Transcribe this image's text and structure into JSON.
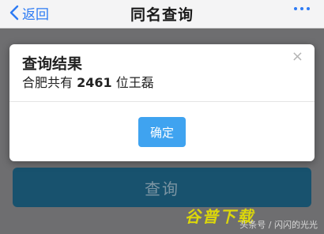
{
  "navbar": {
    "back_label": "返回",
    "title": "同名查询",
    "more_icon": "more-dots-icon",
    "accent_color": "#2d7bf4"
  },
  "page": {
    "query_button_label": "查询"
  },
  "dialog": {
    "title": "查询结果",
    "body_prefix": "合肥共有",
    "count": "2461",
    "body_suffix": "位王磊",
    "close_symbol": "×",
    "ok_label": "确定",
    "ok_color": "#3fa3f0"
  },
  "watermark": {
    "logo_text": "谷普下载",
    "credit": "头条号 / 闪闪的光光"
  }
}
